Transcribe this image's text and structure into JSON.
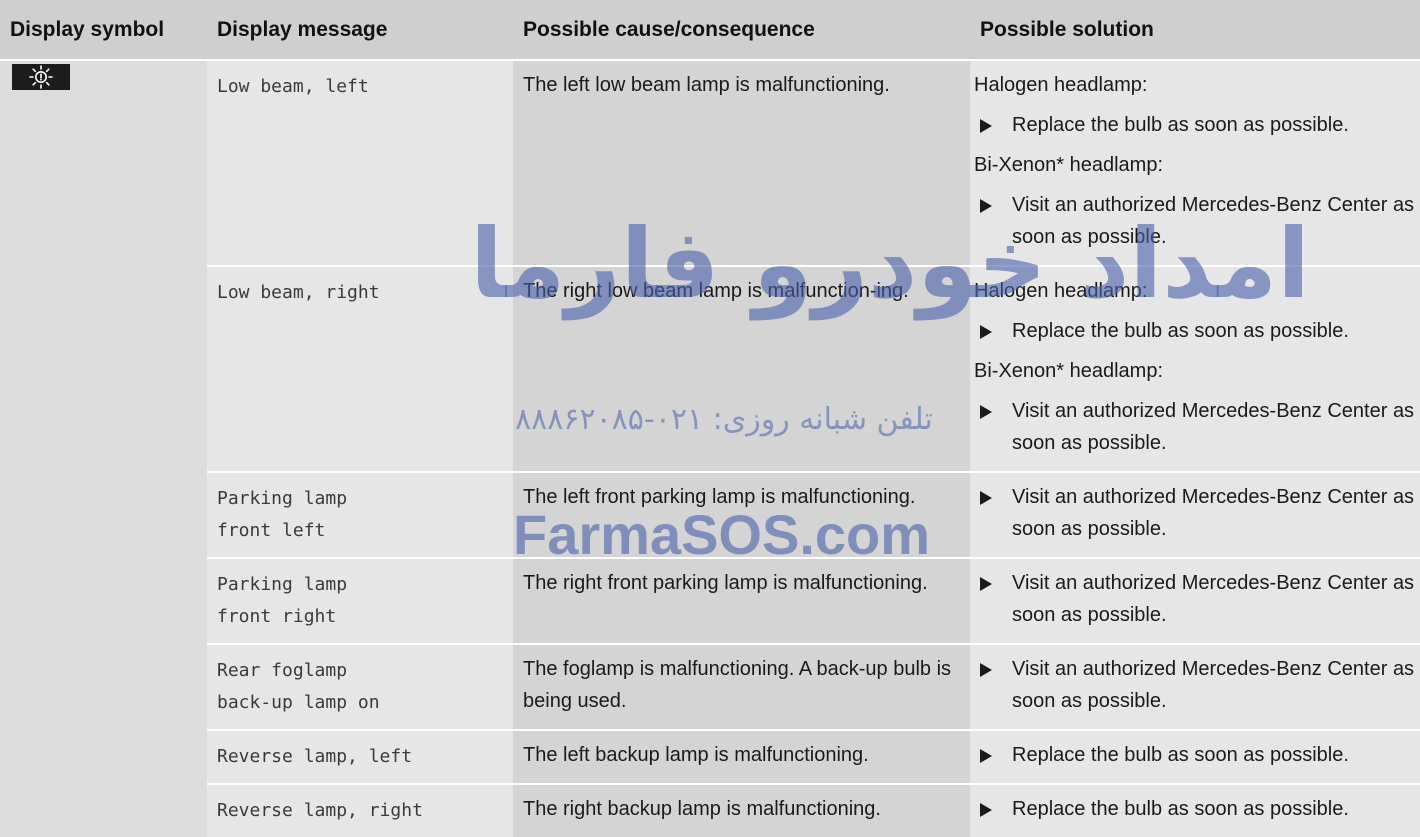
{
  "headers": {
    "symbol": "Display symbol",
    "message": "Display message",
    "cause": "Possible cause/consequence",
    "solution": "Possible solution"
  },
  "symbol_icon": "exterior-lighting-malfunction-icon",
  "rows": [
    {
      "message": "Low beam, left",
      "cause": "The left low beam lamp is malfunctioning.",
      "solution": [
        {
          "type": "text",
          "text": "Halogen headlamp:"
        },
        {
          "type": "step",
          "text": "Replace the bulb as soon as possible."
        },
        {
          "type": "text",
          "text": "Bi-Xenon* headlamp:"
        },
        {
          "type": "step",
          "text": "Visit an authorized Mercedes-Benz Center as soon as possible."
        }
      ]
    },
    {
      "message": "Low beam, right",
      "cause": "The right low beam lamp is malfunction-ing.",
      "solution": [
        {
          "type": "text",
          "text": "Halogen headlamp:"
        },
        {
          "type": "step",
          "text": "Replace the bulb as soon as possible."
        },
        {
          "type": "text",
          "text": "Bi-Xenon* headlamp:"
        },
        {
          "type": "step",
          "text": "Visit an authorized Mercedes-Benz Center as soon as possible."
        }
      ]
    },
    {
      "message": "Parking lamp\nfront left",
      "cause": "The left front parking lamp is malfunctioning.",
      "solution": [
        {
          "type": "step",
          "text": "Visit an authorized Mercedes-Benz Center as soon as possible."
        }
      ]
    },
    {
      "message": "Parking lamp\nfront right",
      "cause": "The right front parking lamp is malfunctioning.",
      "solution": [
        {
          "type": "step",
          "text": "Visit an authorized Mercedes-Benz Center as soon as possible."
        }
      ]
    },
    {
      "message": "Rear foglamp\nback-up lamp on",
      "cause": "The foglamp is malfunctioning. A back-up bulb is being used.",
      "solution": [
        {
          "type": "step",
          "text": "Visit an authorized Mercedes-Benz Center as soon as possible."
        }
      ]
    },
    {
      "message": "Reverse lamp, left",
      "cause": "The left backup lamp is malfunctioning.",
      "solution": [
        {
          "type": "step",
          "text": "Replace the bulb as soon as possible."
        }
      ]
    },
    {
      "message": "Reverse lamp, right",
      "cause": "The right backup lamp is malfunctioning.",
      "solution": [
        {
          "type": "step",
          "text": "Replace the bulb as soon as possible."
        }
      ]
    }
  ],
  "watermark": {
    "persian_brand": "امداد خودرو فارما",
    "phone_line": "تلفن شبانه روزی: ۰۲۱-۸۸۸۶۲۰۸۵",
    "site": "FarmaSOS.com"
  }
}
